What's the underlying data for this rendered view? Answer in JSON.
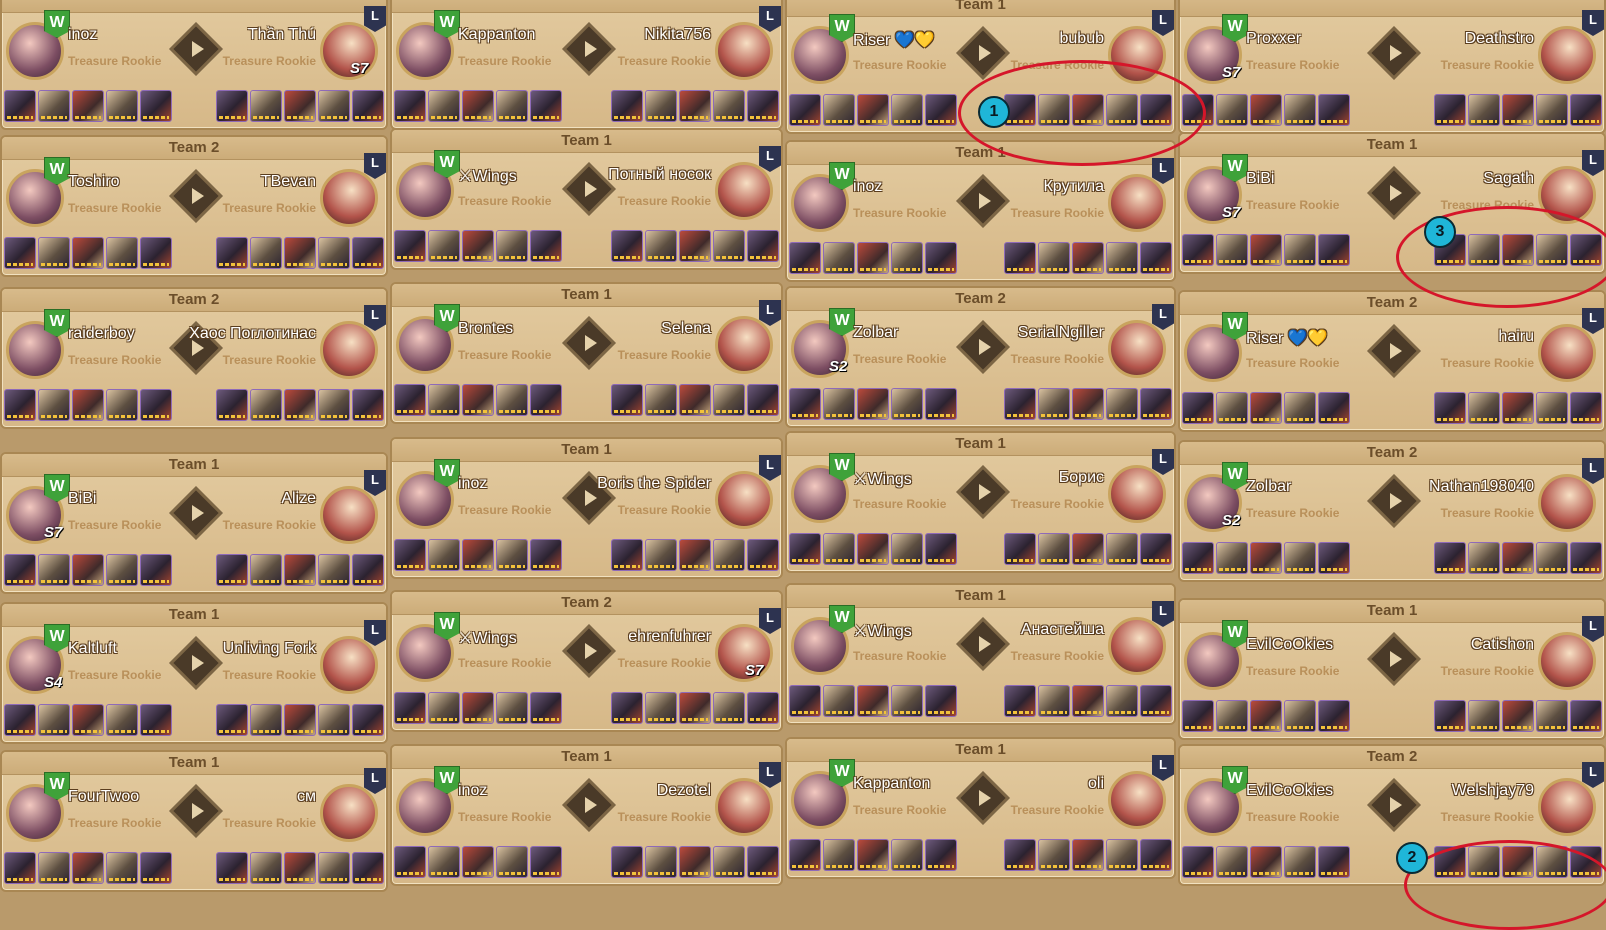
{
  "badges": {
    "win": "W",
    "loss": "L"
  },
  "rank_label": "Treasure Rookie",
  "columns": [
    {
      "cards": [
        {
          "title": "",
          "left": "inoz",
          "right": "Thần Thú",
          "right_tag": "S7"
        },
        {
          "title": "Team 2",
          "left": "Toshiro",
          "right": "TBevan"
        },
        {
          "title": "Team 2",
          "left": "raiderboy",
          "right": "Хаос Поглотинас"
        },
        {
          "title": "Team 1",
          "left": "BiBi",
          "right": "Alize",
          "left_tag": "S7"
        },
        {
          "title": "Team 1",
          "left": "Kaltluft",
          "right": "Unliving Fork",
          "left_tag": "S4"
        },
        {
          "title": "Team 1",
          "left": "FourTwoo",
          "right": "cм"
        }
      ]
    },
    {
      "cards": [
        {
          "title": "",
          "left": "Kappanton",
          "right": "Nikita756"
        },
        {
          "title": "Team 1",
          "left": "⚔Wings",
          "right": "Потный носок"
        },
        {
          "title": "Team 1",
          "left": "Brontes",
          "right": "Selena"
        },
        {
          "title": "Team 1",
          "left": "inoz",
          "right": "Boris the Spider"
        },
        {
          "title": "Team 2",
          "left": "⚔Wings",
          "right": "ehrenfuhrer",
          "right_tag": "S7"
        },
        {
          "title": "Team 1",
          "left": "inoz",
          "right": "Dezotel"
        }
      ]
    },
    {
      "cards": [
        {
          "title": "Team 1",
          "left": "Riser 💙💛",
          "right": "bubub"
        },
        {
          "title": "Team 1",
          "left": "inoz",
          "right": "Крутила"
        },
        {
          "title": "Team 2",
          "left": "Zolbar",
          "right": "SerialNgiller",
          "left_tag": "S2"
        },
        {
          "title": "Team 1",
          "left": "⚔Wings",
          "right": "Борис"
        },
        {
          "title": "Team 1",
          "left": "⚔Wings",
          "right": "Анастейша"
        },
        {
          "title": "Team 1",
          "left": "Kappanton",
          "right": "oli"
        }
      ]
    },
    {
      "cards": [
        {
          "title": "",
          "left": "Proxxer",
          "right": "Deathstro",
          "left_tag": "S7"
        },
        {
          "title": "Team 1",
          "left": "BiBi",
          "right": "Sagath",
          "left_tag": "S7"
        },
        {
          "title": "Team 2",
          "left": "Riser 💙💛",
          "right": "hairu"
        },
        {
          "title": "Team 2",
          "left": "Zolbar",
          "right": "Nathan198040",
          "left_tag": "S2"
        },
        {
          "title": "Team 1",
          "left": "EvilCoOkies",
          "right": "Catishon"
        },
        {
          "title": "Team 2",
          "left": "EvilCoOkies",
          "right": "Welshjay79"
        }
      ]
    }
  ],
  "markers": [
    "1",
    "2",
    "3"
  ],
  "colors": {
    "highlight": "#d5162a",
    "marker": "#1fb6d8",
    "win": "#3fa23a",
    "loss": "#2d3350"
  }
}
